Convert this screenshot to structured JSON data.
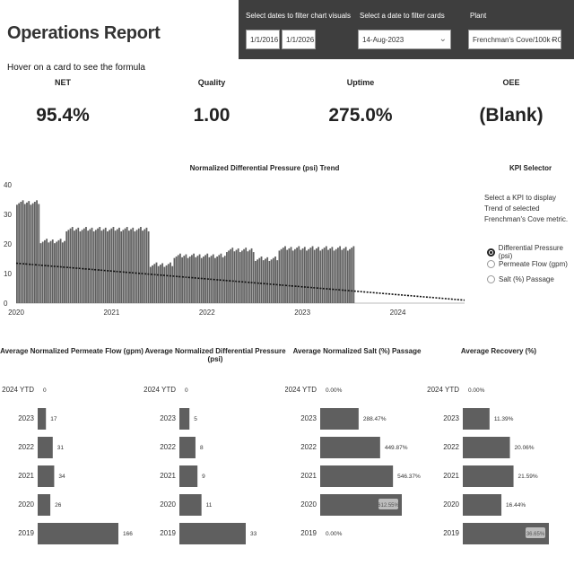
{
  "header": {
    "title": "Operations Report",
    "hint": "Hover on a card to see the formula"
  },
  "filters": {
    "date_range_label": "Select dates to filter chart visuals",
    "date_start": "1/1/2016",
    "date_end": "1/1/2026",
    "card_date_label": "Select a date to filter cards",
    "card_date": "14-Aug-2023",
    "plant_label": "Plant",
    "plant": "Frenchman's Cove/100k RO"
  },
  "cards": [
    {
      "label": "NET",
      "value": "95.4%"
    },
    {
      "label": "Quality",
      "value": "1.00"
    },
    {
      "label": "Uptime",
      "value": "275.0%"
    },
    {
      "label": "OEE",
      "value": "(Blank)"
    }
  ],
  "kpi_selector": {
    "title": "KPI Selector",
    "description": "Select a KPI to display Trend of selected Frenchman's Cove metric.",
    "options": [
      {
        "label": "Differential Pressure (psi)",
        "selected": true
      },
      {
        "label": "Permeate Flow (gpm)",
        "selected": false
      },
      {
        "label": "Salt (%) Passage",
        "selected": false
      }
    ]
  },
  "chart_data": [
    {
      "type": "bar",
      "title": "Normalized Differential Pressure (psi) Trend",
      "x_ticks": [
        "2020",
        "2021",
        "2022",
        "2023",
        "2024"
      ],
      "y_ticks": [
        "0",
        "10",
        "20",
        "30",
        "40"
      ],
      "ylim": [
        0,
        40
      ],
      "x_domain": [
        2020.0,
        2024.7
      ],
      "segments": [
        {
          "x_start": 2020.0,
          "x_end": 2020.25,
          "value": 34
        },
        {
          "x_start": 2020.25,
          "x_end": 2020.52,
          "value": 21
        },
        {
          "x_start": 2020.52,
          "x_end": 2021.4,
          "value": 25
        },
        {
          "x_start": 2021.4,
          "x_end": 2021.65,
          "value": 13
        },
        {
          "x_start": 2021.65,
          "x_end": 2022.2,
          "value": 16
        },
        {
          "x_start": 2022.2,
          "x_end": 2022.5,
          "value": 18
        },
        {
          "x_start": 2022.5,
          "x_end": 2022.75,
          "value": 15
        },
        {
          "x_start": 2022.75,
          "x_end": 2023.55,
          "value": 18.5
        }
      ],
      "trendline": {
        "x": [
          2020.0,
          2024.7
        ],
        "y": [
          13.5,
          1.0
        ],
        "style": "dotted"
      }
    },
    {
      "type": "bar",
      "orientation": "horizontal",
      "title": "Average Normalized Permeate Flow (gpm)",
      "categories": [
        "2024 YTD",
        "2023",
        "2022",
        "2021",
        "2020",
        "2019"
      ],
      "values": [
        0,
        17,
        31,
        34,
        26,
        166
      ],
      "labels": [
        "0",
        "17",
        "31",
        "34",
        "26",
        "166"
      ],
      "max": 166
    },
    {
      "type": "bar",
      "orientation": "horizontal",
      "title": "Average Normalized Differential Pressure (psi)",
      "categories": [
        "2024 YTD",
        "2023",
        "2022",
        "2021",
        "2020",
        "2019"
      ],
      "values": [
        0,
        5,
        8,
        9,
        11,
        33
      ],
      "labels": [
        "0",
        "5",
        "8",
        "9",
        "11",
        "33"
      ],
      "max": 33
    },
    {
      "type": "bar",
      "orientation": "horizontal",
      "title": "Average Normalized Salt (%) Passage",
      "categories": [
        "2024 YTD",
        "2023",
        "2022",
        "2021",
        "2020",
        "2019"
      ],
      "values": [
        0,
        288.47,
        449.87,
        546.37,
        612.55,
        0
      ],
      "labels": [
        "0.00%",
        "288.47%",
        "449.87%",
        "546.37%",
        "612.55%",
        "0.00%"
      ],
      "max": 612.55
    },
    {
      "type": "bar",
      "orientation": "horizontal",
      "title": "Average Recovery (%)",
      "categories": [
        "2024 YTD",
        "2023",
        "2022",
        "2021",
        "2020",
        "2019"
      ],
      "values": [
        0,
        11.39,
        20.06,
        21.59,
        16.44,
        36.65
      ],
      "labels": [
        "0.00%",
        "11.39%",
        "20.06%",
        "21.59%",
        "16.44%",
        "36.65%"
      ],
      "max": 36.65
    }
  ],
  "colors": {
    "bar": "#5f5f5f",
    "filter_bg": "#3e3e3e",
    "label_badge": "#bdbdbd"
  }
}
